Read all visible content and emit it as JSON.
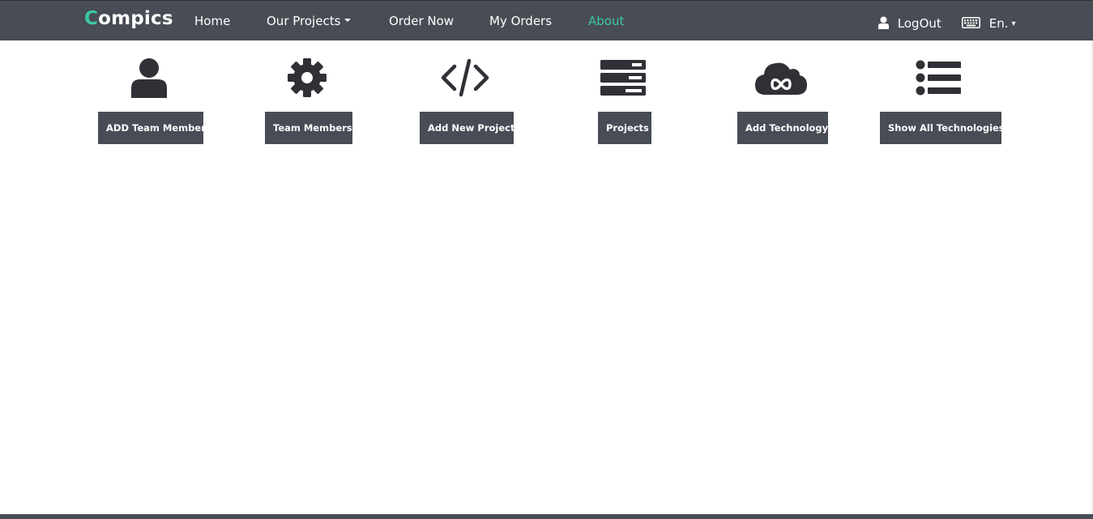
{
  "brand": {
    "first_letter": "C",
    "rest": "ompics"
  },
  "nav": {
    "home": "Home",
    "our_projects": "Our Projects",
    "order_now": "Order Now",
    "my_orders": "My Orders",
    "about": "About"
  },
  "right_nav": {
    "logout": "LogOut",
    "language": "En.",
    "language_caret": "▾"
  },
  "actions": [
    {
      "label": "ADD Team Member",
      "icon": "user-icon"
    },
    {
      "label": "Team Members",
      "icon": "gear-icon"
    },
    {
      "label": "Add New Project",
      "icon": "code-icon"
    },
    {
      "label": "Projects",
      "icon": "server-icon"
    },
    {
      "label": "Add Technology",
      "icon": "cloud-infinity-icon"
    },
    {
      "label": "Show All Technologies",
      "icon": "list-icon"
    }
  ],
  "colors": {
    "navbar_bg": "#484c54",
    "accent": "#3cc9a0",
    "icon": "#2f3136",
    "button_bg": "#484c54"
  }
}
